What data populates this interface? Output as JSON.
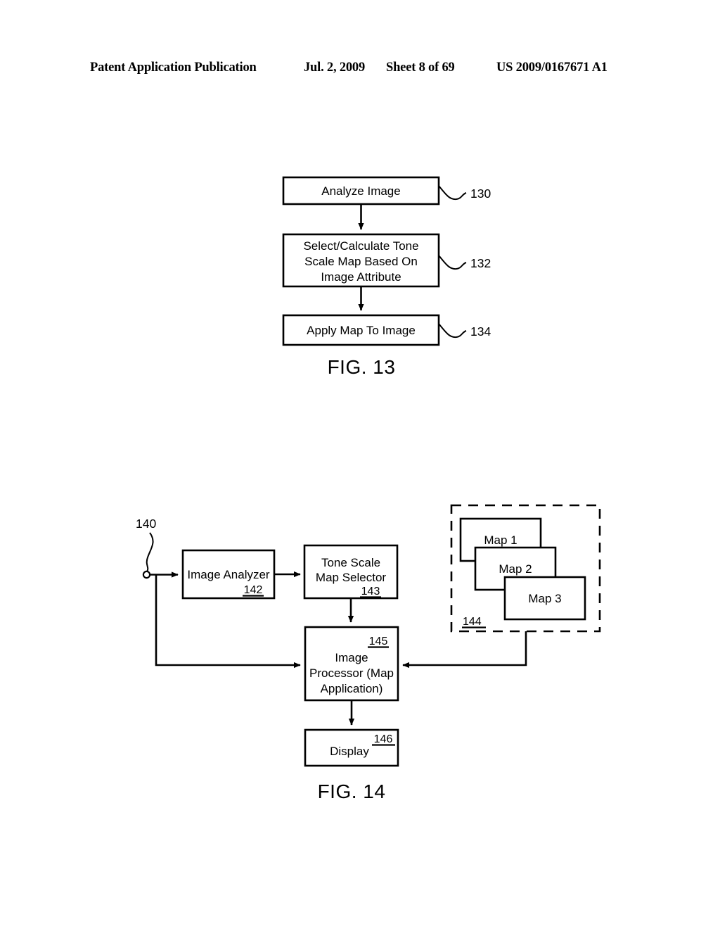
{
  "header": {
    "publication": "Patent Application Publication",
    "date": "Jul. 2, 2009",
    "sheet": "Sheet 8 of 69",
    "document_number": "US 2009/0167671 A1"
  },
  "figures": [
    {
      "caption": "FIG. 13",
      "type": "flowchart",
      "steps": [
        {
          "label": "Analyze Image",
          "ref": "130"
        },
        {
          "label": "Select/Calculate Tone Scale Map Based On Image Attribute",
          "ref": "132"
        },
        {
          "label": "Apply Map To Image",
          "ref": "134"
        }
      ]
    },
    {
      "caption": "FIG. 14",
      "type": "block-diagram",
      "system_ref": "140",
      "blocks": [
        {
          "label": "Image Analyzer",
          "ref": "142"
        },
        {
          "label": "Tone Scale Map Selector",
          "ref": "143"
        },
        {
          "label": "Image Processor (Map Application)",
          "ref": "145"
        },
        {
          "label": "Display",
          "ref": "146"
        }
      ],
      "map_store": {
        "ref": "144",
        "maps": [
          "Map 1",
          "Map 2",
          "Map 3"
        ]
      }
    }
  ],
  "fig13": {
    "step1_line1": "Analyze Image",
    "step1_ref": "130",
    "step2_line1": "Select/Calculate Tone",
    "step2_line2": "Scale Map Based On",
    "step2_line3": "Image Attribute",
    "step2_ref": "132",
    "step3_line1": "Apply Map To Image",
    "step3_ref": "134",
    "caption": "FIG. 13"
  },
  "fig14": {
    "system_ref": "140",
    "analyzer_line1": "Image Analyzer",
    "analyzer_ref": "142",
    "selector_line1": "Tone Scale",
    "selector_line2": "Map Selector",
    "selector_ref": "143",
    "processor_line1": "Image",
    "processor_line2": "Processor (Map",
    "processor_line3": "Application)",
    "processor_ref": "145",
    "display_label": "Display",
    "display_ref": "146",
    "map1": "Map 1",
    "map2": "Map 2",
    "map3": "Map 3",
    "store_ref": "144",
    "caption": "FIG. 14"
  },
  "colors": {
    "ink": "#000000",
    "paper": "#ffffff"
  }
}
